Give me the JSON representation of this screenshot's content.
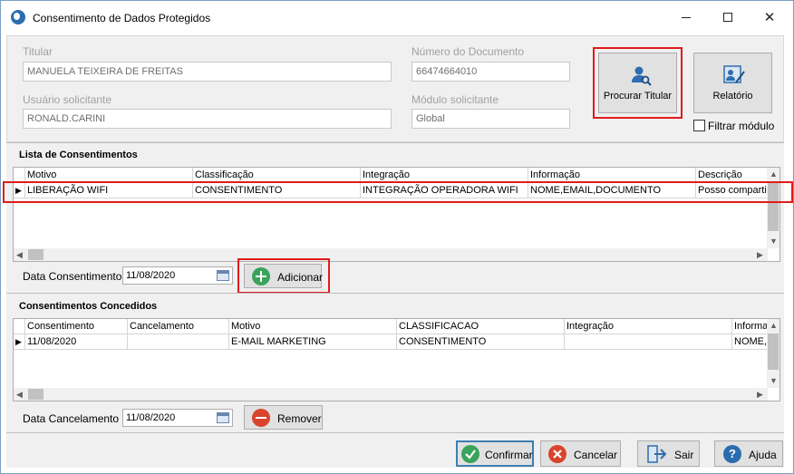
{
  "window": {
    "title": "Consentimento de Dados Protegidos",
    "min_glyph": "—",
    "close_glyph": "✕"
  },
  "fields": {
    "titular_label": "Titular",
    "titular_value": "MANUELA TEIXEIRA DE FREITAS",
    "documento_label": "Número do Documento",
    "documento_value": "66474664010",
    "usuario_label": "Usuário solicitante",
    "usuario_value": "RONALD.CARINI",
    "modulo_label": "Módulo solicitante",
    "modulo_value": "Global"
  },
  "actions": {
    "procurar_label": "Procurar Titular",
    "relatorio_label": "Relatório",
    "filtrar_label": "Filtrar módulo"
  },
  "lista": {
    "header": "Lista de Consentimentos",
    "columns": [
      "Motivo",
      "Classificação",
      "Integração",
      "Informação",
      "Descrição"
    ],
    "rows": [
      [
        "LIBERAÇÃO WIFI",
        "CONSENTIMENTO",
        "INTEGRAÇÃO OPERADORA WIFI",
        "NOME,EMAIL,DOCUMENTO",
        "Posso comparti"
      ]
    ],
    "date_label": "Data Consentimento",
    "date_value": "11/08/2020",
    "add_label": "Adicionar"
  },
  "concedidos": {
    "header": "Consentimentos Concedidos",
    "columns": [
      "Consentimento",
      "Cancelamento",
      "Motivo",
      "CLASSIFICACAO",
      "Integração",
      "Informa"
    ],
    "rows": [
      [
        "11/08/2020",
        "",
        "E-MAIL MARKETING",
        "CONSENTIMENTO",
        "",
        "NOME,E"
      ]
    ],
    "date_label": "Data Cancelamento",
    "date_value": "11/08/2020",
    "remove_label": "Remover"
  },
  "footer": {
    "confirmar": "Confirmar",
    "cancelar": "Cancelar",
    "sair": "Sair",
    "ajuda": "Ajuda"
  },
  "icons": {
    "app": "globe-icon",
    "procurar": "user-search-icon",
    "relatorio": "report-icon",
    "adicionar": "plus-circle-icon",
    "remover": "minus-circle-icon",
    "confirmar": "check-circle-icon",
    "cancelar": "x-circle-icon",
    "sair": "exit-icon",
    "ajuda": "help-icon"
  },
  "colors": {
    "highlight_border": "#e01b1b",
    "add_green": "#3aa35b",
    "remove_red": "#d9442c",
    "confirm_green": "#3aa35b",
    "cancel_red": "#d9442c",
    "help_blue": "#2b6cb0"
  }
}
